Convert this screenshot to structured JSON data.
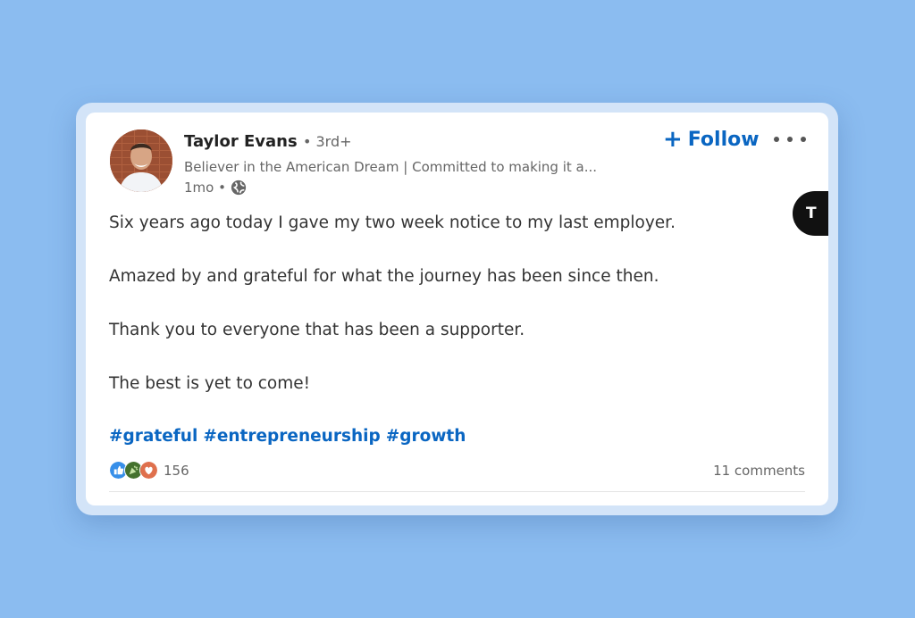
{
  "post": {
    "author": {
      "name": "Taylor Evans",
      "degree": "• 3rd+",
      "headline": "Believer in the American Dream | Committed to making it a...",
      "posted": "1mo •"
    },
    "follow_label": "Follow",
    "follow_icon": "plus-icon",
    "badge_letter": "T",
    "body": [
      "Six years ago today I gave my two week notice to my last employer.",
      "Amazed by and grateful for what the journey has been since then.",
      "Thank you to everyone that has been a supporter.",
      "The best is yet to come!"
    ],
    "hashtags": [
      "#grateful",
      "#entrepreneurship",
      "#growth"
    ],
    "reactions": {
      "count": "156",
      "icons": [
        "like-icon",
        "celebrate-icon",
        "love-icon"
      ]
    },
    "comments": "11 comments"
  },
  "colors": {
    "background": "#8bbcf0",
    "link": "#0a66c2",
    "text": "#333333"
  }
}
